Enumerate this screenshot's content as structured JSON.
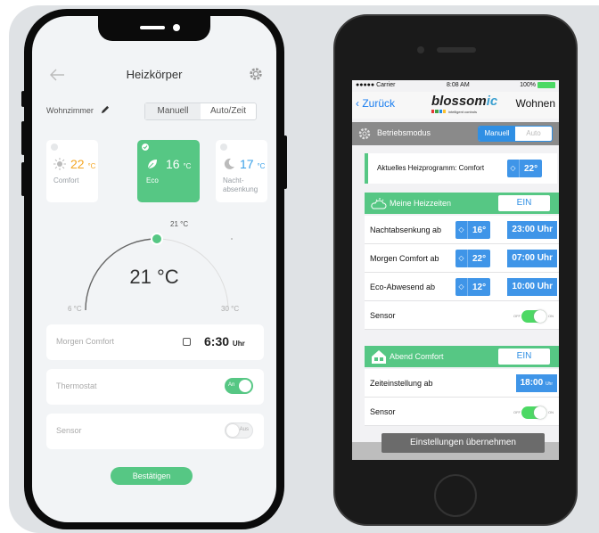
{
  "left_app": {
    "title": "Heizkörper",
    "room": "Wohnzimmer",
    "tabs": [
      "Manuell",
      "Auto/Zeit"
    ],
    "modes": [
      {
        "temp": "22",
        "unit": "°C",
        "label": "Comfort",
        "color": "#f5a623"
      },
      {
        "temp": "16",
        "unit": "°C",
        "label": "Eco",
        "color": "#ffffff"
      },
      {
        "temp": "17",
        "unit": "°C",
        "label": "Nacht-\nabsenkung",
        "color": "#3aa0e8"
      }
    ],
    "dial": {
      "current": "21 °C",
      "setpoint": "21 °C",
      "min": "6 °C",
      "max": "30 °C"
    },
    "schedule": {
      "label": "Morgen Comfort",
      "time": "6:30",
      "unit": "Uhr"
    },
    "thermostat": {
      "label": "Thermostat",
      "toggle": "An"
    },
    "sensor": {
      "label": "Sensor",
      "toggle": "Aus"
    },
    "confirm_label": "Bestätigen",
    "accent": "#56c784"
  },
  "right_app": {
    "status": {
      "carrier": "●●●●● Carrier",
      "time": "8:08 AM",
      "battery": "100%"
    },
    "nav": {
      "back": "Zurück",
      "brand_main": "blossom",
      "brand_accent": "ic",
      "brand_sub": "intelligent controls",
      "right": "Wohnen"
    },
    "betriebsmodus": {
      "label": "Betriebsmodus",
      "tabs": [
        "Manuell",
        "Auto"
      ]
    },
    "current_program": {
      "label": "Aktuelles Heizprogramm: Comfort",
      "temp": "22°"
    },
    "heizzeiten": {
      "title": "Meine Heizzeiten",
      "state": "EIN",
      "rows": [
        {
          "label": "Nachtabsenkung ab",
          "temp": "16°",
          "time": "23:00 Uhr"
        },
        {
          "label": "Morgen Comfort ab",
          "temp": "22°",
          "time": "07:00 Uhr"
        },
        {
          "label": "Eco-Abwesend ab",
          "temp": "12°",
          "time": "10:00 Uhr"
        }
      ],
      "sensor_label": "Sensor"
    },
    "abend": {
      "title": "Abend Comfort",
      "state": "EIN",
      "time_label": "Zeiteinstellung ab",
      "time": "18:00",
      "time_unit": "Uhr",
      "sensor_label": "Sensor"
    },
    "toggle_labels": {
      "off": "OFF",
      "on": "ON"
    },
    "apply_label": "Einstellungen übernehmen",
    "accent": "#56c784",
    "blue": "#3f95e8"
  }
}
